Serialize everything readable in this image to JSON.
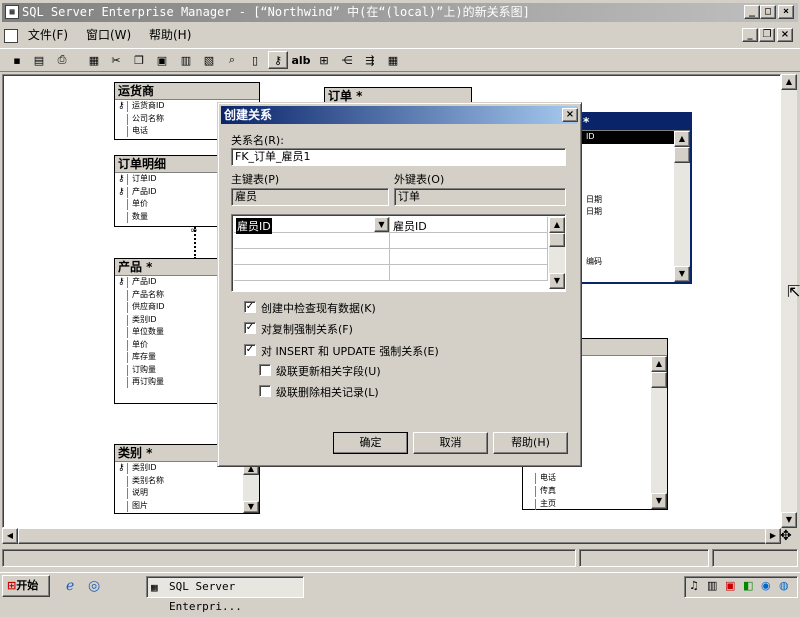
{
  "app": {
    "title": "SQL Server Enterprise Manager - [“Northwind” 中(在“(local)”上)的新关系图]",
    "window_controls": [
      "_",
      "□",
      "×"
    ],
    "child_controls": [
      "_",
      "❐",
      "×"
    ]
  },
  "menu": {
    "items": [
      "文件(F)",
      "窗口(W)",
      "帮助(H)"
    ]
  },
  "toolbar": {
    "buttons": [
      "save-icon",
      "properties-icon",
      "print-icon",
      "new-table-icon",
      "cut-icon",
      "copy-icon",
      "paste-icon",
      "add-table-icon",
      "add-related-icon",
      "zoom-icon",
      "show-icon",
      "key-icon",
      "alb",
      "relationship-icon",
      "layout-icon",
      "arrange-icon",
      "indexes-icon"
    ],
    "alb_label": "alb"
  },
  "diagram": {
    "tables": [
      {
        "title": "运货商",
        "rows": [
          {
            "text": "运货商ID",
            "key": true
          },
          {
            "text": "公司名称"
          },
          {
            "text": "电话"
          }
        ]
      },
      {
        "title": "订单明细",
        "rows": [
          {
            "text": "订单ID",
            "key": true
          },
          {
            "text": "产品ID",
            "key": true
          },
          {
            "text": "单价"
          },
          {
            "text": "数量"
          }
        ]
      },
      {
        "title": "产品 *",
        "rows": [
          {
            "text": "产品ID",
            "key": true
          },
          {
            "text": "产品名称"
          },
          {
            "text": "供应商ID"
          },
          {
            "text": "类别ID"
          },
          {
            "text": "单位数量"
          },
          {
            "text": "单价"
          },
          {
            "text": "库存量"
          },
          {
            "text": "订购量"
          },
          {
            "text": "再订购量"
          }
        ]
      },
      {
        "title": "类别 *",
        "rows": [
          {
            "text": "类别ID",
            "key": true
          },
          {
            "text": "类别名称"
          },
          {
            "text": "说明"
          },
          {
            "text": "图片"
          }
        ]
      },
      {
        "title": "订单 *",
        "rows": []
      },
      {
        "title": "*",
        "rows": [
          {
            "text": "ID",
            "selected": true
          },
          {
            "text": ""
          },
          {
            "text": ""
          },
          {
            "text": ""
          },
          {
            "text": ""
          },
          {
            "text": "日期"
          },
          {
            "text": "日期"
          },
          {
            "text": ""
          },
          {
            "text": ""
          },
          {
            "text": ""
          },
          {
            "text": "编码"
          }
        ]
      },
      {
        "title": "",
        "rows": [
          {
            "text": "电话"
          },
          {
            "text": "传真"
          },
          {
            "text": "主页"
          }
        ]
      }
    ]
  },
  "dialog": {
    "title": "创建关系",
    "close": "×",
    "relationship_name_label": "关系名(R):",
    "relationship_name_value": "FK_订单_雇员1",
    "primary_table_label": "主键表(P)",
    "primary_table_value": "雇员",
    "foreign_table_label": "外键表(O)",
    "foreign_table_value": "订单",
    "columns": [
      {
        "primary": "雇员ID",
        "foreign": "雇员ID"
      }
    ],
    "options": [
      {
        "label": "创建中检查现有数据(K)",
        "checked": true
      },
      {
        "label": "对复制强制关系(F)",
        "checked": true
      },
      {
        "label": "对 INSERT 和 UPDATE 强制关系(E)",
        "checked": true
      },
      {
        "label": "级联更新相关字段(U)",
        "checked": false
      },
      {
        "label": "级联删除相关记录(L)",
        "checked": false
      }
    ],
    "ok": "确定",
    "cancel": "取消",
    "help": "帮助(H)"
  },
  "taskbar": {
    "start": "开始",
    "task": "SQL Server Enterpri..."
  }
}
